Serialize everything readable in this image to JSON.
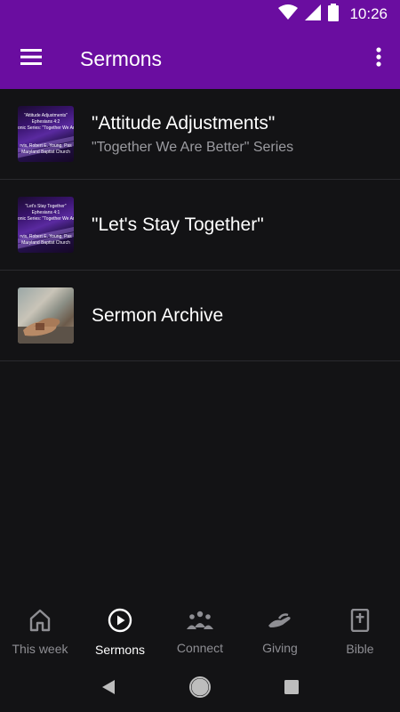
{
  "status_bar": {
    "time": "10:26"
  },
  "app_bar": {
    "title": "Sermons"
  },
  "sermons": [
    {
      "title": "\"Attitude Adjustments\"",
      "subtitle": "\"Together We Are Better\" Series",
      "thumb_lines": [
        "\"Attitude Adjustments\"",
        "Ephesians 4:2",
        "onic Series: \"Together We Are B",
        "",
        "rvis, Robert E. Young, Pas",
        "Maryland Baptist Church"
      ]
    },
    {
      "title": "\"Let's Stay Together\"",
      "subtitle": "",
      "thumb_lines": [
        "\"Let's Stay Together\"",
        "Ephesians 4:1",
        "onic Series: \"Together We Are B",
        "",
        "rvis, Robert E. Young, Pas",
        "Maryland Baptist Church"
      ]
    },
    {
      "title": "Sermon Archive",
      "subtitle": ""
    }
  ],
  "bottom_nav": [
    {
      "label": "This week",
      "icon": "home-icon",
      "active": false
    },
    {
      "label": "Sermons",
      "icon": "play-circle-icon",
      "active": true
    },
    {
      "label": "Connect",
      "icon": "people-icon",
      "active": false
    },
    {
      "label": "Giving",
      "icon": "giving-hand-icon",
      "active": false
    },
    {
      "label": "Bible",
      "icon": "bible-icon",
      "active": false
    }
  ],
  "colors": {
    "app_bar": "#6a0da0",
    "background": "#131315",
    "inactive": "#8e8e93"
  }
}
